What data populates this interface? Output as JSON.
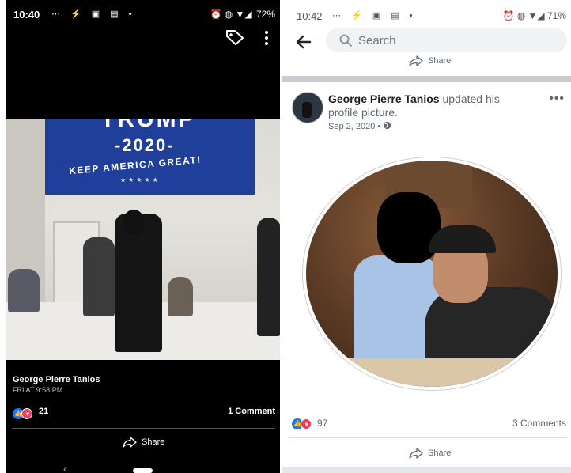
{
  "left": {
    "status_bar": {
      "time": "10:40",
      "left_icons": "⋯ ⚡ ▣ ▤ •",
      "right_icons": "⏰ ◍ ▼◢",
      "battery": "72%"
    },
    "banner": {
      "line1": "TRUMP",
      "line2": "-2020-",
      "line3": "KEEP AMERICA GREAT!",
      "stars": "★★★★★"
    },
    "post": {
      "author": "George Pierre Tanios",
      "time": "FRI AT 9:58 PM",
      "reaction_count": "21",
      "comments": "1 Comment",
      "share_label": "Share"
    },
    "nav": {
      "back": "‹"
    },
    "icons": [
      "tag-icon",
      "more-vertical-icon",
      "like-icon",
      "love-icon",
      "share-icon"
    ]
  },
  "right": {
    "status_bar": {
      "time": "10:42",
      "left_icons": "⋯ ⚡ ▣ ▤ •",
      "right_icons": "⏰ ◍ ▼◢",
      "battery": "71%"
    },
    "search": {
      "placeholder": "Search"
    },
    "share_top_label": "Share",
    "post": {
      "author": "George Pierre Tanios",
      "action": " updated his profile picture.",
      "date": "Sep 2, 2020 •",
      "reaction_count": "97",
      "comments": "3 Comments",
      "share_label": "Share",
      "more": "•••"
    },
    "icons": [
      "back-arrow-icon",
      "search-icon",
      "globe-icon",
      "like-icon",
      "love-icon",
      "share-icon"
    ]
  },
  "colors": {
    "facebook_blue": "#1877f2",
    "love_red": "#f33e58",
    "banner_blue": "#1f3f9a"
  }
}
